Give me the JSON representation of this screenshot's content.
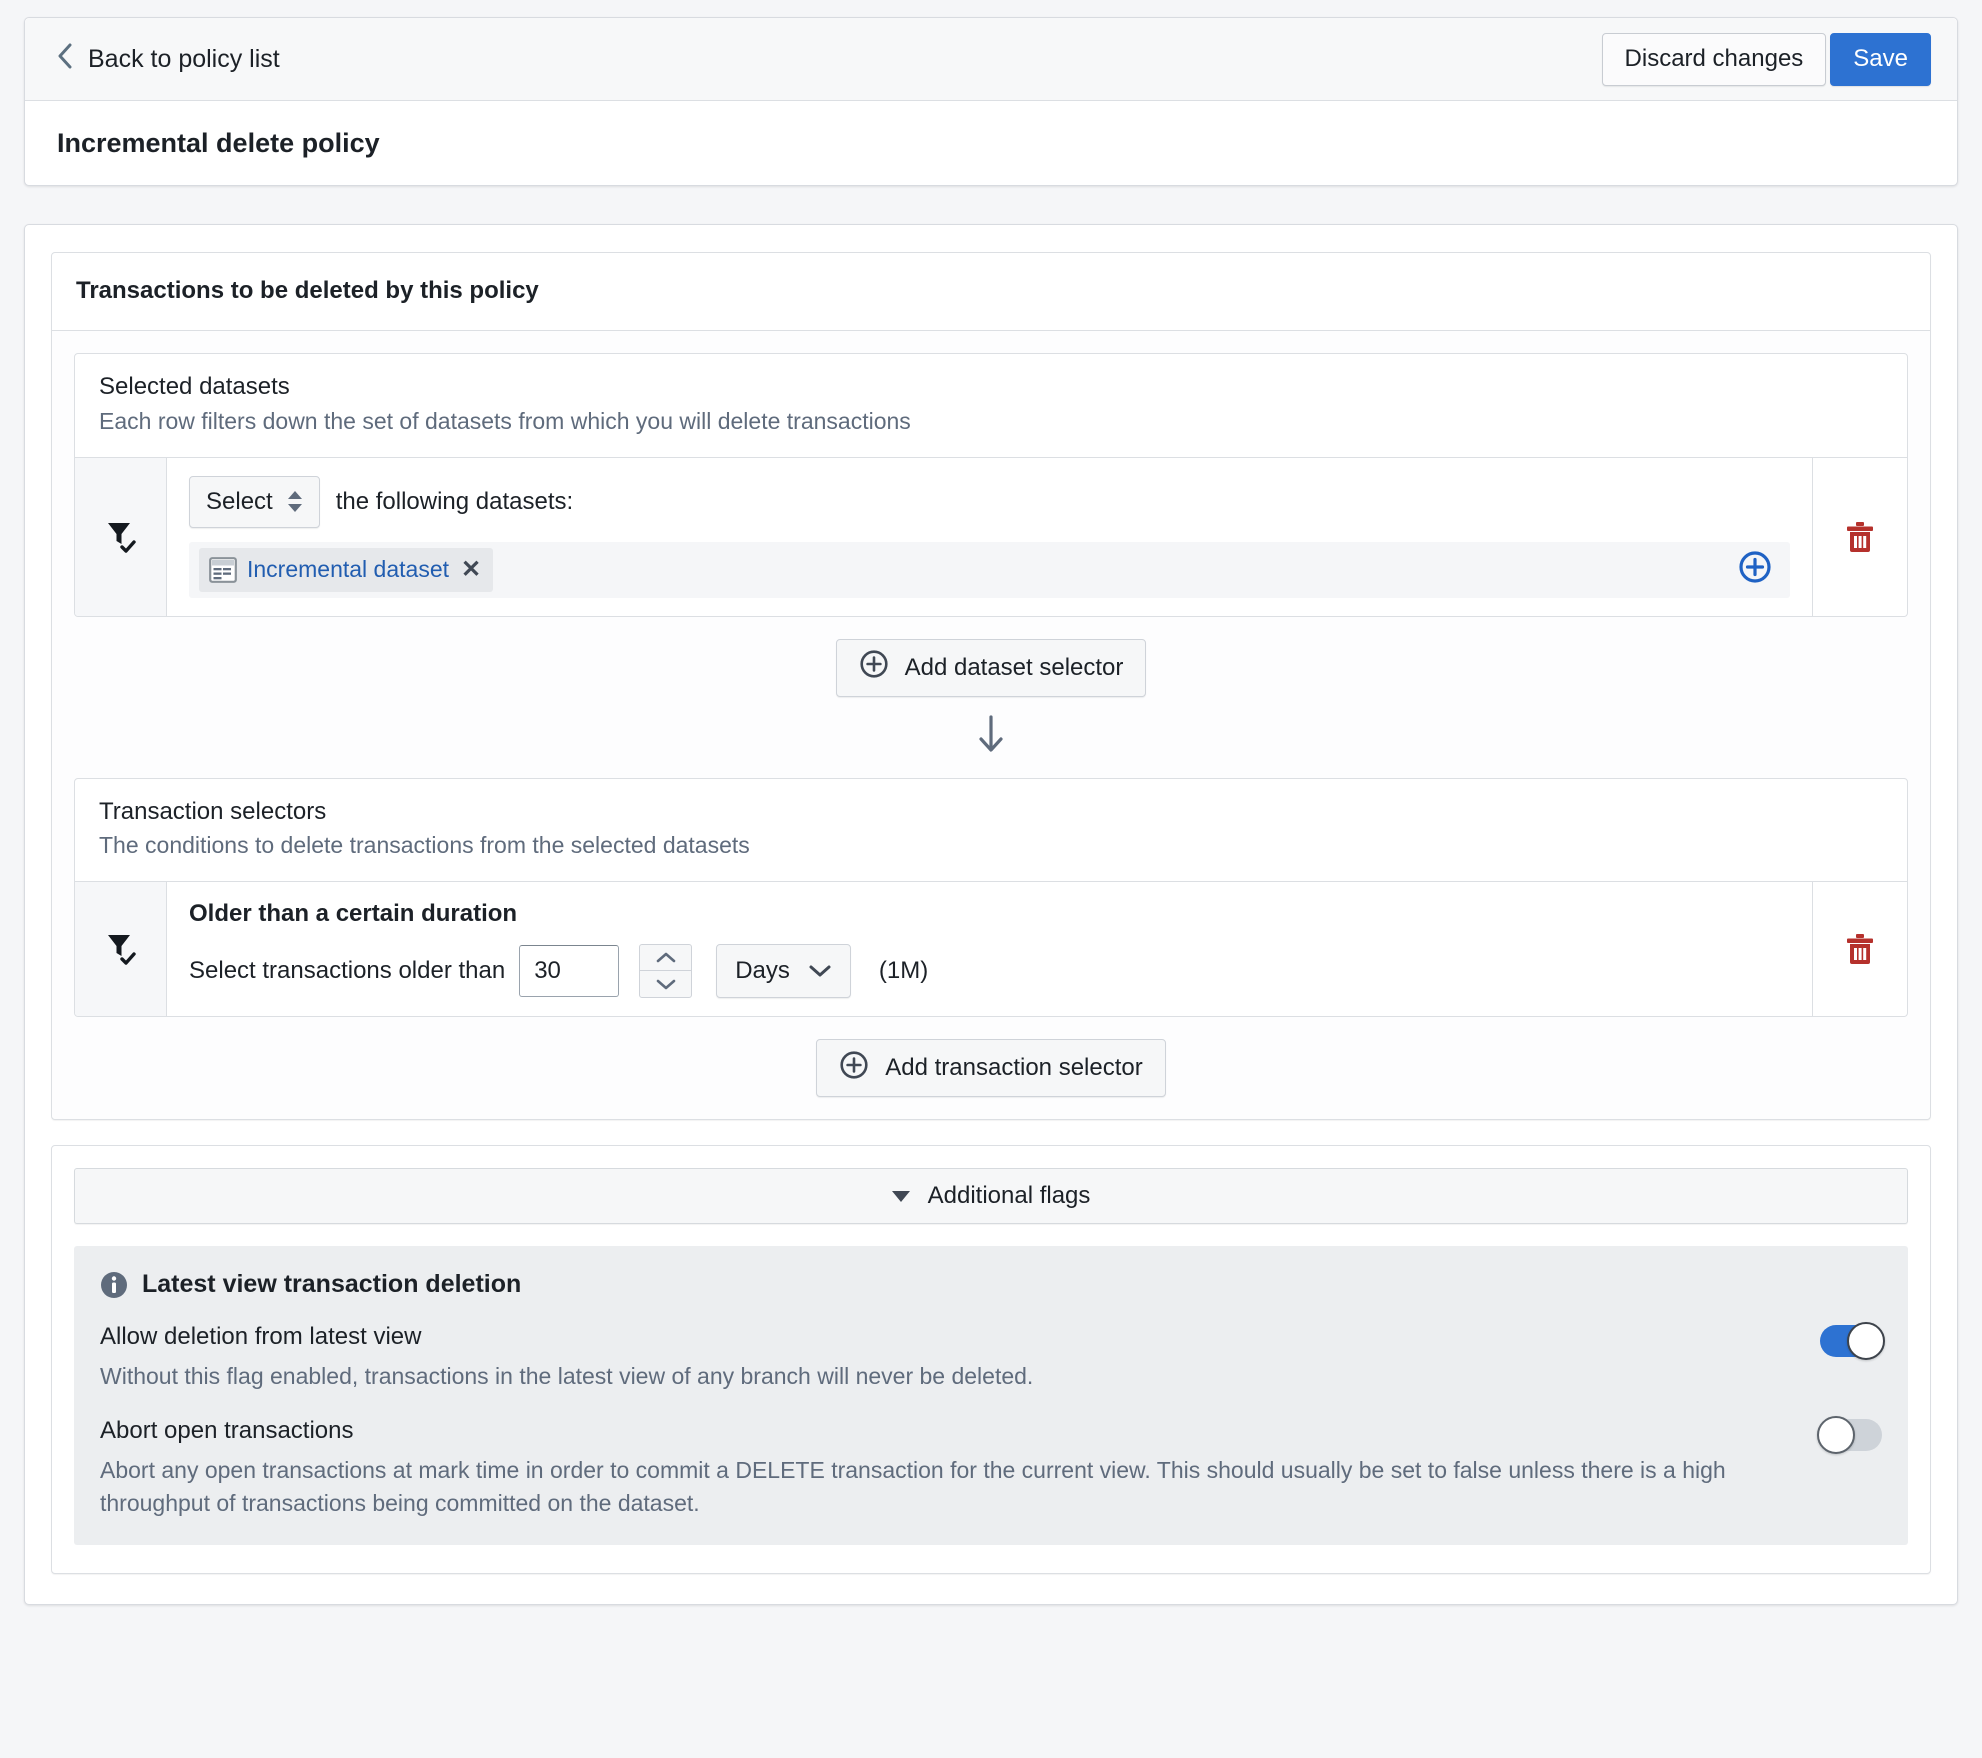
{
  "header": {
    "back_label": "Back to policy list",
    "discard_label": "Discard changes",
    "save_label": "Save",
    "page_title": "Incremental delete policy"
  },
  "section": {
    "title": "Transactions to be deleted by this policy"
  },
  "datasets": {
    "title": "Selected datasets",
    "subtitle": "Each row filters down the set of datasets from which you will delete transactions",
    "select_value": "Select",
    "select_suffix": "the following datasets:",
    "tags": [
      {
        "label": "Incremental dataset",
        "remove": "✕"
      }
    ],
    "add_selector_label": "Add dataset selector"
  },
  "transactions": {
    "title": "Transaction selectors",
    "subtitle": "The conditions to delete transactions from the selected datasets",
    "selector_title": "Older than a certain duration",
    "selector_label": "Select transactions older than",
    "amount_value": "30",
    "unit_value": "Days",
    "unit_hint": "(1M)",
    "add_selector_label": "Add transaction selector"
  },
  "flags": {
    "collapse_label": "Additional flags",
    "panel_title": "Latest view transaction deletion",
    "rows": [
      {
        "label": "Allow deletion from latest view",
        "desc": "Without this flag enabled, transactions in the latest view of any branch will never be deleted.",
        "state": "on"
      },
      {
        "label": "Abort open transactions",
        "desc": "Abort any open transactions at mark time in order to commit a DELETE transaction for the current view. This should usually be set to false unless there is a high throughput of transactions being committed on the dataset.",
        "state": "off"
      }
    ]
  },
  "colors": {
    "accent": "#2d72d2",
    "danger": "#b5312c",
    "link": "#215db0",
    "muted": "#5f6b7c",
    "page_bg": "#f5f6f8",
    "panel_bg": "#eceef0"
  }
}
